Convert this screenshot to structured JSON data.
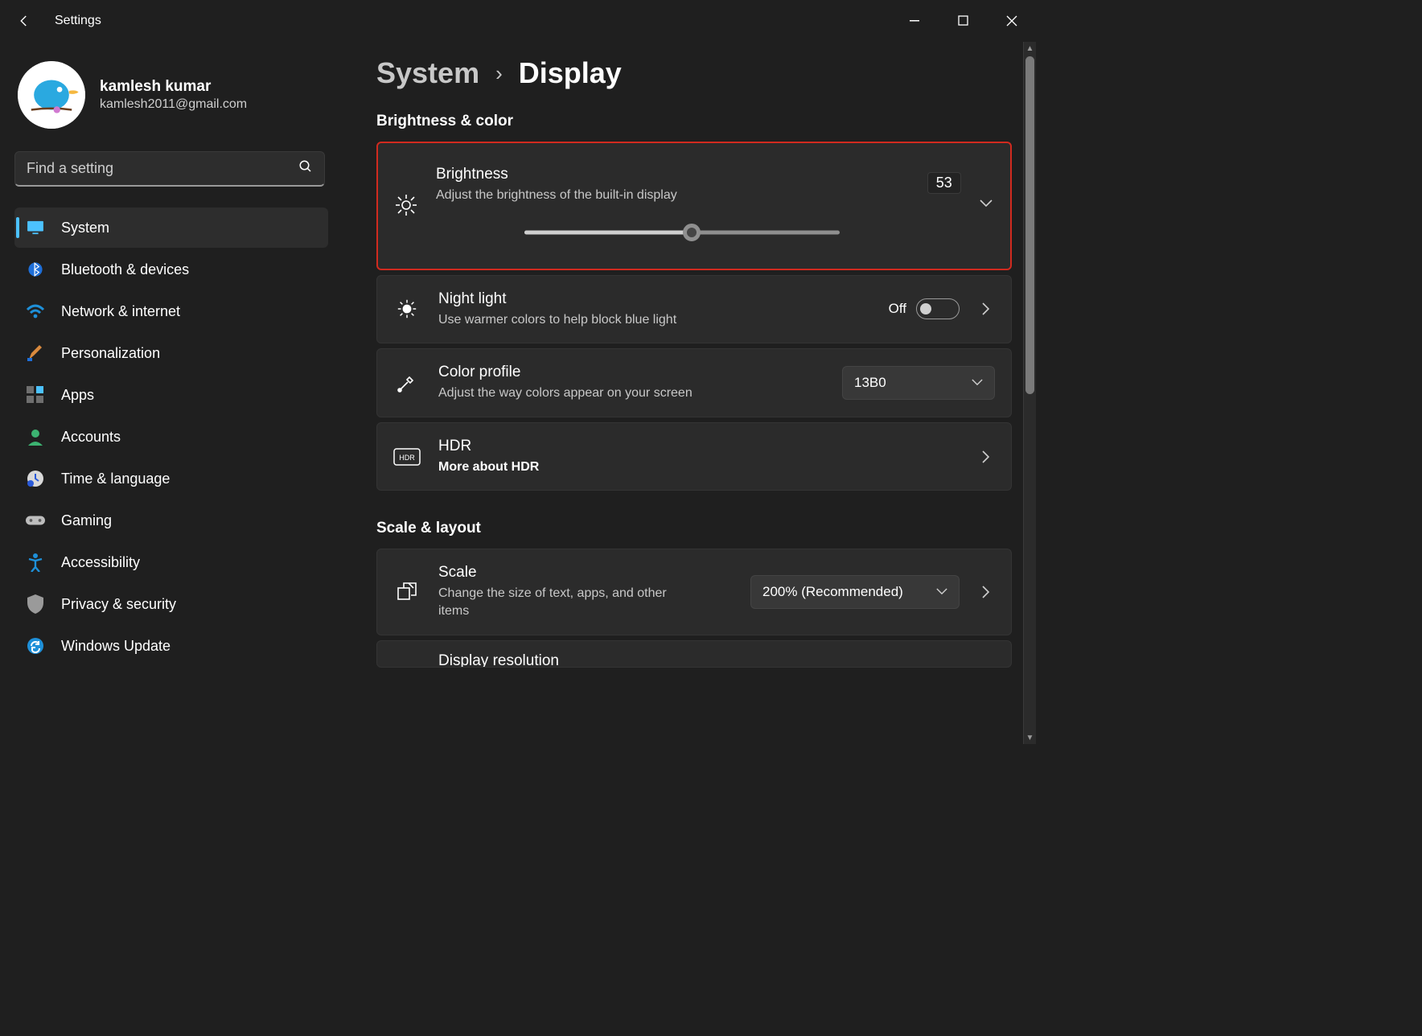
{
  "app": {
    "title": "Settings"
  },
  "user": {
    "name": "kamlesh kumar",
    "email": "kamlesh2011@gmail.com"
  },
  "search": {
    "placeholder": "Find a setting"
  },
  "nav": {
    "items": [
      {
        "label": "System"
      },
      {
        "label": "Bluetooth & devices"
      },
      {
        "label": "Network & internet"
      },
      {
        "label": "Personalization"
      },
      {
        "label": "Apps"
      },
      {
        "label": "Accounts"
      },
      {
        "label": "Time & language"
      },
      {
        "label": "Gaming"
      },
      {
        "label": "Accessibility"
      },
      {
        "label": "Privacy & security"
      },
      {
        "label": "Windows Update"
      }
    ]
  },
  "breadcrumb": {
    "parent": "System",
    "current": "Display"
  },
  "sections": {
    "brightness_color": {
      "title": "Brightness & color",
      "brightness": {
        "title": "Brightness",
        "subtitle": "Adjust the brightness of the built-in display",
        "value": "53",
        "percent": 53
      },
      "night_light": {
        "title": "Night light",
        "subtitle": "Use warmer colors to help block blue light",
        "state_label": "Off"
      },
      "color_profile": {
        "title": "Color profile",
        "subtitle": "Adjust the way colors appear on your screen",
        "selected": "13B0"
      },
      "hdr": {
        "title": "HDR",
        "subtitle": "More about HDR"
      }
    },
    "scale_layout": {
      "title": "Scale & layout",
      "scale": {
        "title": "Scale",
        "subtitle": "Change the size of text, apps, and other items",
        "selected": "200% (Recommended)"
      },
      "display_resolution": {
        "title": "Display resolution"
      }
    }
  }
}
